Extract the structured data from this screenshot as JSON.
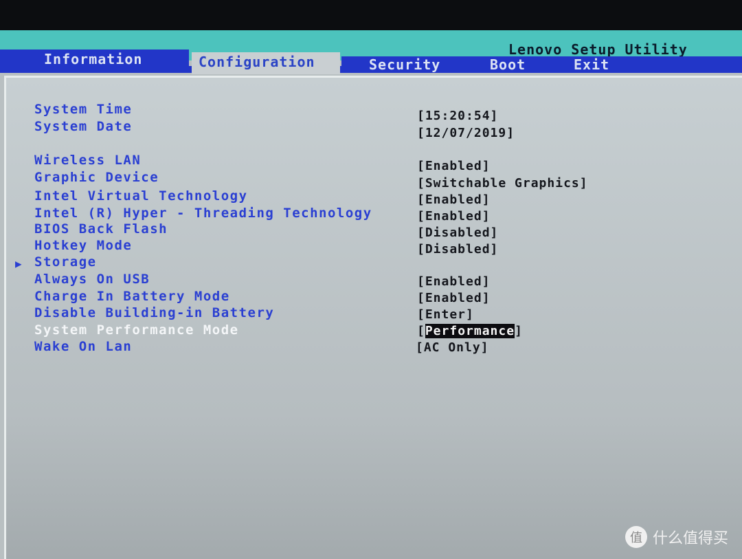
{
  "header": {
    "title": "Lenovo Setup Utility"
  },
  "tabs": [
    {
      "label": "Information"
    },
    {
      "label": "Configuration",
      "active": true
    },
    {
      "label": "Security"
    },
    {
      "label": "Boot"
    },
    {
      "label": "Exit"
    }
  ],
  "items": [
    {
      "label": "System Time",
      "value": "[15:20:54]"
    },
    {
      "label": "System Date",
      "value": "[12/07/2019]"
    },
    {
      "label": "Wireless LAN",
      "value": "[Enabled]"
    },
    {
      "label": "Graphic Device",
      "value": "[Switchable Graphics]"
    },
    {
      "label": "Intel Virtual Technology",
      "value": "[Enabled]"
    },
    {
      "label": "Intel (R) Hyper - Threading Technology",
      "value": "[Enabled]"
    },
    {
      "label": "BIOS Back Flash",
      "value": "[Disabled]"
    },
    {
      "label": "Hotkey Mode",
      "value": "[Disabled]"
    },
    {
      "label": "Storage",
      "value": ""
    },
    {
      "label": "Always On USB",
      "value": "[Enabled]"
    },
    {
      "label": "Charge In Battery Mode",
      "value": "[Enabled]"
    },
    {
      "label": "Disable Building-in Battery",
      "value": "[Enter]"
    },
    {
      "label": "System Performance Mode",
      "value": "Performance"
    },
    {
      "label": "Wake On Lan",
      "value": "[AC Only]"
    }
  ],
  "selected_item": "System Performance Mode",
  "watermark": {
    "logo": "值",
    "text": "什么值得买"
  },
  "colors": {
    "tab_bar": "#2236c8",
    "header": "#4cc3bd",
    "item_text": "#2a3fd2",
    "panel": "#c7cfd2"
  }
}
